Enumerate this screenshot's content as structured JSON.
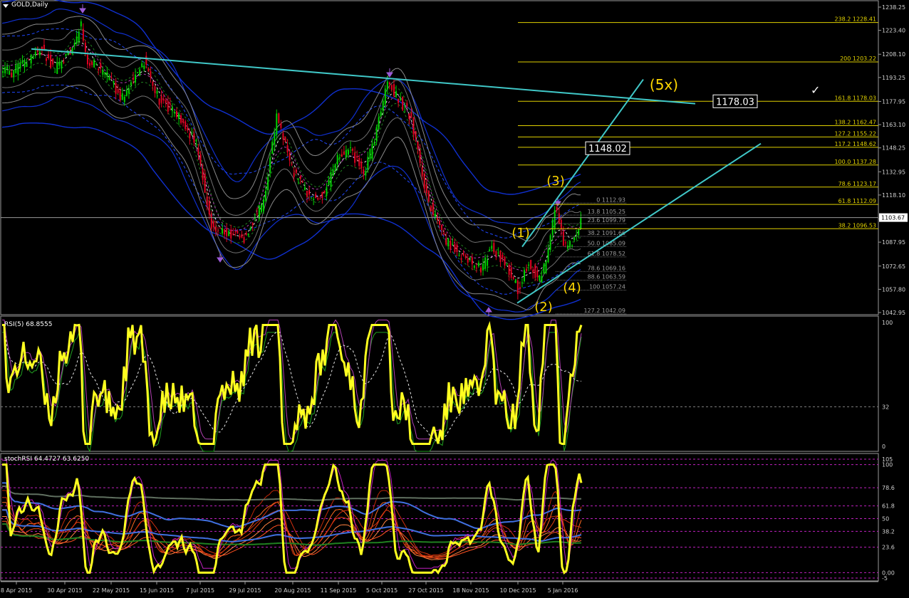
{
  "window": {
    "symbol_title": "GOLD,Daily"
  },
  "main_axis": {
    "ticks": [
      "1238.25",
      "1223.40",
      "1208.10",
      "1193.25",
      "1177.95",
      "1163.10",
      "1148.25",
      "1132.95",
      "1118.10",
      "1102.80",
      "1087.95",
      "1072.65",
      "1057.80",
      "1042.95"
    ],
    "current_price": "1103.67"
  },
  "date_axis": [
    "8 Apr 2015",
    "30 Apr 2015",
    "22 May 2015",
    "15 Jun 2015",
    "7 Jul 2015",
    "29 Jul 2015",
    "20 Aug 2015",
    "11 Sep 2015",
    "5 Oct 2015",
    "27 Oct 2015",
    "18 Nov 2015",
    "10 Dec 2015",
    "5 Jan 2016"
  ],
  "fibo_ext": [
    {
      "label": "238.2 1228.41",
      "price": 1228.41
    },
    {
      "label": "200 1203.22",
      "price": 1203.22
    },
    {
      "label": "161.8 1178.03",
      "price": 1178.03
    },
    {
      "label": "138.2 1162.47",
      "price": 1162.47
    },
    {
      "label": "127.2 1155.22",
      "price": 1155.22
    },
    {
      "label": "117.2 1148.62",
      "price": 1148.62
    },
    {
      "label": "100.0 1137.28",
      "price": 1137.28
    },
    {
      "label": "78.6 1123.17",
      "price": 1123.17
    },
    {
      "label": "61.8 1112.09",
      "price": 1112.09
    },
    {
      "label": "38.2 1096.53",
      "price": 1096.53
    }
  ],
  "fibo_retr": [
    {
      "label": "0 1112.93",
      "price": 1112.93
    },
    {
      "label": "13.8 1105.25",
      "price": 1105.25
    },
    {
      "label": "23.6 1099.79",
      "price": 1099.79
    },
    {
      "label": "38.2 1091.66",
      "price": 1091.66
    },
    {
      "label": "50.0 1085.09",
      "price": 1085.09
    },
    {
      "label": "61.8 1078.52",
      "price": 1078.52
    },
    {
      "label": "78.6 1069.16",
      "price": 1069.16
    },
    {
      "label": "88.6 1063.59",
      "price": 1063.59
    },
    {
      "label": "100 1057.24",
      "price": 1057.24
    },
    {
      "label": "127.2 1042.09",
      "price": 1042.09
    }
  ],
  "boxes": [
    "1178.03",
    "1148.02"
  ],
  "waves": [
    "(1)",
    "(2)",
    "(3)",
    "(4)",
    "(5x)"
  ],
  "rsi": {
    "title": "RSI(5) 68.8555",
    "ticks": [
      "100",
      "32",
      "0"
    ]
  },
  "stoch": {
    "title": "stochRSI 64.4727 63.6250",
    "ticks": [
      "105",
      "100",
      "78.6",
      "61.8",
      "50",
      "38.2",
      "23.6",
      "0.00",
      "-5"
    ]
  },
  "check_mark": "✓",
  "colors": {
    "bull": "#00d000",
    "bear": "#e00020",
    "fibo": "#e0d000",
    "trend": "#40c8c8",
    "wave": "#ffd700",
    "rsi": "#ffff20",
    "band": "#1030d0",
    "grid": "#808080"
  }
}
